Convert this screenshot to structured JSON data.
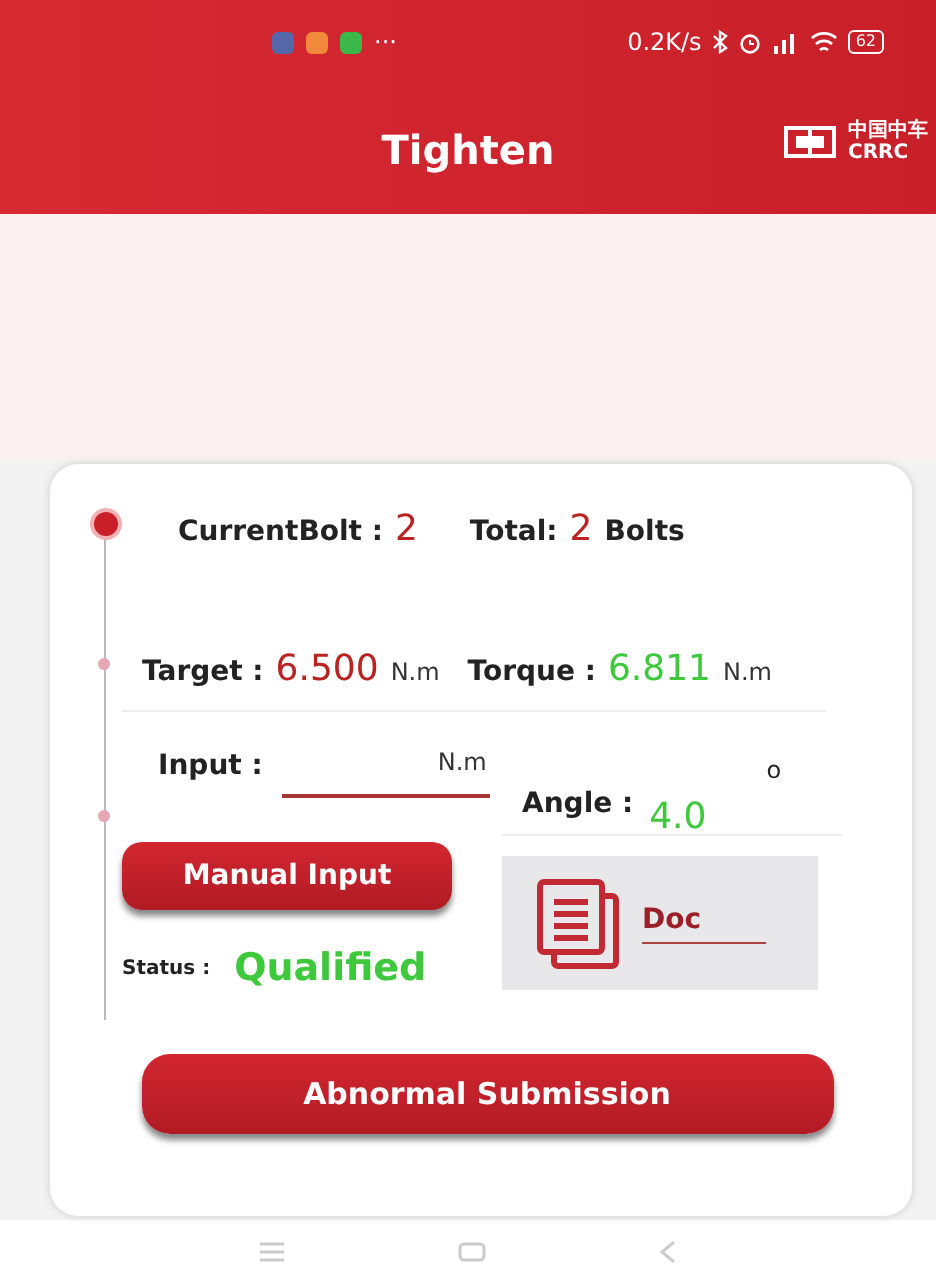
{
  "status_bar": {
    "overflow": "···",
    "net_speed": "0.2K/s",
    "battery": "62"
  },
  "header": {
    "title": "Tighten",
    "logo_cn": "中国中车",
    "logo_en": "CRRC"
  },
  "timeline": [
    {
      "kind": "current"
    },
    {
      "kind": "step"
    },
    {
      "kind": "step"
    }
  ],
  "bolt": {
    "current_label": "CurrentBolt :",
    "current": "2",
    "total_label": "Total:",
    "total": "2",
    "total_unit": "Bolts"
  },
  "target": {
    "label": "Target :",
    "value": "6.500",
    "unit": "N.m"
  },
  "torque": {
    "label": "Torque :",
    "value": "6.811",
    "unit": "N.m"
  },
  "input": {
    "label": "Input :",
    "unit": "N.m"
  },
  "angle": {
    "label": "Angle :",
    "value": "4.0",
    "unit": "o"
  },
  "manual_button": "Manual Input",
  "status": {
    "label": "Status :",
    "value": "Qualified"
  },
  "doc": {
    "label": "Doc"
  },
  "submit_button": "Abnormal Submission"
}
